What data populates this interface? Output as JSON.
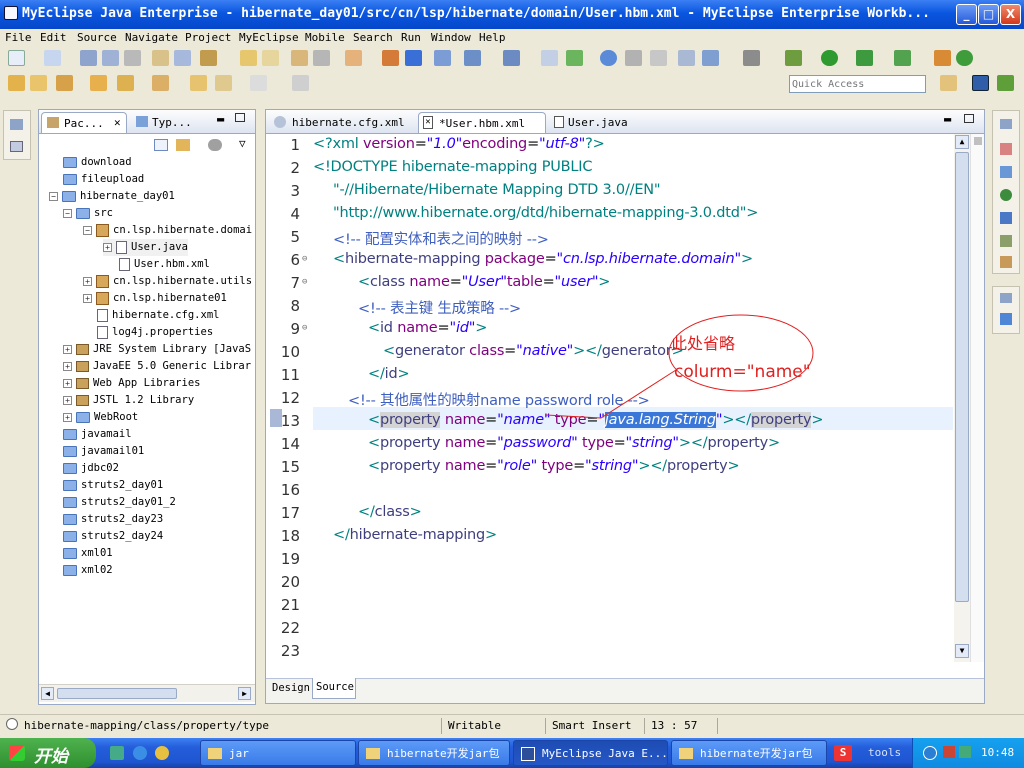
{
  "window": {
    "title": "MyEclipse Java Enterprise - hibernate_day01/src/cn/lsp/hibernate/domain/User.hbm.xml - MyEclipse Enterprise Workb...",
    "min": "_",
    "max": "□",
    "close": "X"
  },
  "menu": [
    "File",
    "Edit",
    "Source",
    "Navigate",
    "Project",
    "MyEclipse",
    "Mobile",
    "Search",
    "Run",
    "Window",
    "Help"
  ],
  "quick_access_placeholder": "Quick Access",
  "left_tabs": {
    "package_explorer": "Pac...",
    "type_hierarchy": "Typ..."
  },
  "tree": [
    {
      "label": "download",
      "icon": "folder"
    },
    {
      "label": "fileupload",
      "icon": "folder"
    },
    {
      "label": "hibernate_day01",
      "icon": "project"
    },
    {
      "label": "src",
      "icon": "folder"
    },
    {
      "label": "cn.lsp.hibernate.domai",
      "icon": "package"
    },
    {
      "label": "User.java",
      "icon": "java-file"
    },
    {
      "label": "User.hbm.xml",
      "icon": "xml-file"
    },
    {
      "label": "cn.lsp.hibernate.utils",
      "icon": "package"
    },
    {
      "label": "cn.lsp.hibernate01",
      "icon": "package"
    },
    {
      "label": "hibernate.cfg.xml",
      "icon": "xml-file"
    },
    {
      "label": "log4j.properties",
      "icon": "file"
    },
    {
      "label": "JRE System Library [JavaS",
      "icon": "library"
    },
    {
      "label": "JavaEE 5.0 Generic Librar",
      "icon": "library"
    },
    {
      "label": "Web App Libraries",
      "icon": "library"
    },
    {
      "label": "JSTL 1.2 Library",
      "icon": "library"
    },
    {
      "label": "WebRoot",
      "icon": "folder"
    },
    {
      "label": "javamail",
      "icon": "folder"
    },
    {
      "label": "javamail01",
      "icon": "folder"
    },
    {
      "label": "jdbc02",
      "icon": "folder"
    },
    {
      "label": "struts2_day01",
      "icon": "folder"
    },
    {
      "label": "struts2_day01_2",
      "icon": "folder"
    },
    {
      "label": "struts2_day23",
      "icon": "folder"
    },
    {
      "label": "struts2_day24",
      "icon": "folder"
    },
    {
      "label": "xml01",
      "icon": "folder"
    },
    {
      "label": "xml02",
      "icon": "folder"
    }
  ],
  "editor_tabs": [
    "hibernate.cfg.xml",
    "*User.hbm.xml",
    "User.java"
  ],
  "code": {
    "l1": {
      "a": "<?xml ",
      "b": "version",
      "c": "=",
      "d": "\"1.0\"",
      "e": "encoding",
      "f": "=",
      "g": "\"utf-8\"",
      "h": "?>"
    },
    "l2": "<!DOCTYPE hibernate-mapping PUBLIC",
    "l3": "\"-//Hibernate/Hibernate Mapping DTD 3.0//EN\"",
    "l4": "\"http://www.hibernate.org/dtd/hibernate-mapping-3.0.dtd\">",
    "l5": "<!-- 配置实体和表之间的映射 -->",
    "l6": {
      "a": "<",
      "b": "hibernate-mapping",
      "c": " package",
      "d": "=",
      "e": "\"cn.lsp.hibernate.domain\"",
      "f": ">"
    },
    "l7": {
      "a": "<",
      "b": "class",
      "c": " name",
      "d": "=",
      "e": "\"User\"",
      "f": "table",
      "g": "=",
      "h": "\"user\"",
      "i": ">"
    },
    "l8": "<!-- 表主键  生成策略  -->",
    "l9": {
      "a": "<",
      "b": "id",
      "c": " name",
      "d": "=",
      "e": "\"id\"",
      "f": ">"
    },
    "l10": {
      "a": "<",
      "b": "generator",
      "c": " class",
      "d": "=",
      "e": "\"native\"",
      "f": "></",
      "g": "generator",
      "h": ">"
    },
    "l11": {
      "a": "</",
      "b": "id",
      "c": ">"
    },
    "l12": "<!-- 其他属性的映射name  password  role -->",
    "l13": {
      "a": "<",
      "b": "property",
      "c": " name",
      "d": "=",
      "e": "\"name\"",
      "f": " type",
      "g": "=",
      "h": "\"",
      "i": "java.lang.String",
      "j": "\"",
      "k": "></",
      "l": "property",
      "m": ">"
    },
    "l14": {
      "a": "<",
      "b": "property",
      "c": " name",
      "d": "=",
      "e": "\"password\"",
      "f": " type",
      "g": "=",
      "h": "\"string\"",
      "i": "></",
      "j": "property",
      "k": ">"
    },
    "l15": {
      "a": "<",
      "b": "property",
      "c": " name",
      "d": "=",
      "e": "\"role\"",
      "f": " type",
      "g": "=",
      "h": "\"string\"",
      "i": "></",
      "j": "property",
      "k": ">"
    },
    "l17": {
      "a": "</",
      "b": "class",
      "c": ">"
    },
    "l18": {
      "a": "</",
      "b": "hibernate-mapping",
      "c": ">"
    }
  },
  "line_numbers": [
    "1",
    "2",
    "3",
    "4",
    "5",
    "6",
    "7",
    "8",
    "9",
    "10",
    "11",
    "12",
    "13",
    "14",
    "15",
    "16",
    "17",
    "18",
    "19",
    "20",
    "21",
    "22",
    "23"
  ],
  "annotation": {
    "line1": "此处省略",
    "line2": "colurm=\"name\""
  },
  "bottom_tabs": [
    "Design",
    "Source"
  ],
  "status": {
    "path": "hibernate-mapping/class/property/type",
    "writable": "Writable",
    "insert": "Smart Insert",
    "position": "13 : 57"
  },
  "taskbar": {
    "start": "开始",
    "tasks": [
      "jar",
      "hibernate开发jar包",
      "MyEclipse Java E...",
      "hibernate开发jar包"
    ],
    "tools": "tools",
    "clock": "10:48"
  },
  "colors": {
    "accent": "#0a56e0",
    "annotation": "#e02020"
  }
}
